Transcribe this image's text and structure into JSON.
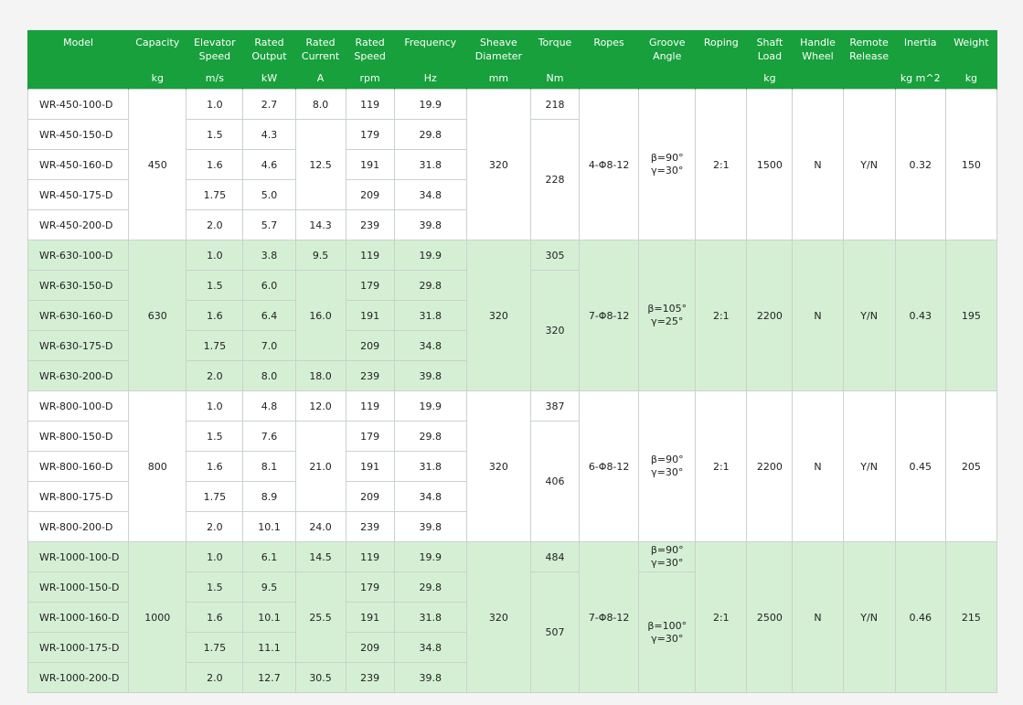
{
  "header": {
    "titles": [
      [
        "Model"
      ],
      [
        "Capacity"
      ],
      [
        "Elevator",
        "Speed"
      ],
      [
        "Rated",
        "Output"
      ],
      [
        "Rated",
        "Current"
      ],
      [
        "Rated",
        "Speed"
      ],
      [
        "Frequency"
      ],
      [
        "Sheave",
        "Diameter"
      ],
      [
        "Torque"
      ],
      [
        "Ropes"
      ],
      [
        "Groove",
        "Angle"
      ],
      [
        "Roping"
      ],
      [
        "Shaft",
        "Load"
      ],
      [
        "Handle",
        "Wheel"
      ],
      [
        "Remote",
        "Release"
      ],
      [
        "Inertia"
      ],
      [
        "Weight"
      ]
    ],
    "units": [
      "",
      "kg",
      "m/s",
      "kW",
      "A",
      "rpm",
      "Hz",
      "mm",
      "Nm",
      "",
      "",
      "",
      "kg",
      "",
      "",
      "kg m^2",
      "kg"
    ]
  },
  "groups": [
    {
      "capacity": "450",
      "sheave": "320",
      "ropes": "4-Φ8-12",
      "roping": "2:1",
      "shaft_load": "1500",
      "handle_wheel": "N",
      "remote_release": "Y/N",
      "inertia": "0.32",
      "weight": "150",
      "groove_angles": [
        [
          "β=90°",
          "γ=30°"
        ]
      ],
      "currents": [
        "8.0",
        "12.5",
        "14.3"
      ],
      "torques": [
        "218",
        "228"
      ],
      "rows": [
        {
          "model": "WR-450-100-D",
          "speed": "1.0",
          "output": "2.7",
          "rpm": "119",
          "hz": "19.9"
        },
        {
          "model": "WR-450-150-D",
          "speed": "1.5",
          "output": "4.3",
          "rpm": "179",
          "hz": "29.8"
        },
        {
          "model": "WR-450-160-D",
          "speed": "1.6",
          "output": "4.6",
          "rpm": "191",
          "hz": "31.8"
        },
        {
          "model": "WR-450-175-D",
          "speed": "1.75",
          "output": "5.0",
          "rpm": "209",
          "hz": "34.8"
        },
        {
          "model": "WR-450-200-D",
          "speed": "2.0",
          "output": "5.7",
          "rpm": "239",
          "hz": "39.8"
        }
      ]
    },
    {
      "capacity": "630",
      "sheave": "320",
      "ropes": "7-Φ8-12",
      "roping": "2:1",
      "shaft_load": "2200",
      "handle_wheel": "N",
      "remote_release": "Y/N",
      "inertia": "0.43",
      "weight": "195",
      "groove_angles": [
        [
          "β=105°",
          "γ=25°"
        ]
      ],
      "currents": [
        "9.5",
        "16.0",
        "18.0"
      ],
      "torques": [
        "305",
        "320"
      ],
      "rows": [
        {
          "model": "WR-630-100-D",
          "speed": "1.0",
          "output": "3.8",
          "rpm": "119",
          "hz": "19.9"
        },
        {
          "model": "WR-630-150-D",
          "speed": "1.5",
          "output": "6.0",
          "rpm": "179",
          "hz": "29.8"
        },
        {
          "model": "WR-630-160-D",
          "speed": "1.6",
          "output": "6.4",
          "rpm": "191",
          "hz": "31.8"
        },
        {
          "model": "WR-630-175-D",
          "speed": "1.75",
          "output": "7.0",
          "rpm": "209",
          "hz": "34.8"
        },
        {
          "model": "WR-630-200-D",
          "speed": "2.0",
          "output": "8.0",
          "rpm": "239",
          "hz": "39.8"
        }
      ]
    },
    {
      "capacity": "800",
      "sheave": "320",
      "ropes": "6-Φ8-12",
      "roping": "2:1",
      "shaft_load": "2200",
      "handle_wheel": "N",
      "remote_release": "Y/N",
      "inertia": "0.45",
      "weight": "205",
      "groove_angles": [
        [
          "β=90°",
          "γ=30°"
        ]
      ],
      "currents": [
        "12.0",
        "21.0",
        "24.0"
      ],
      "torques": [
        "387",
        "406"
      ],
      "rows": [
        {
          "model": "WR-800-100-D",
          "speed": "1.0",
          "output": "4.8",
          "rpm": "119",
          "hz": "19.9"
        },
        {
          "model": "WR-800-150-D",
          "speed": "1.5",
          "output": "7.6",
          "rpm": "179",
          "hz": "29.8"
        },
        {
          "model": "WR-800-160-D",
          "speed": "1.6",
          "output": "8.1",
          "rpm": "191",
          "hz": "31.8"
        },
        {
          "model": "WR-800-175-D",
          "speed": "1.75",
          "output": "8.9",
          "rpm": "209",
          "hz": "34.8"
        },
        {
          "model": "WR-800-200-D",
          "speed": "2.0",
          "output": "10.1",
          "rpm": "239",
          "hz": "39.8"
        }
      ]
    },
    {
      "capacity": "1000",
      "sheave": "320",
      "ropes": "7-Φ8-12",
      "roping": "2:1",
      "shaft_load": "2500",
      "handle_wheel": "N",
      "remote_release": "Y/N",
      "inertia": "0.46",
      "weight": "215",
      "groove_angles": [
        [
          "β=90°",
          "γ=30°"
        ],
        [
          "β=100°",
          "γ=30°"
        ]
      ],
      "currents": [
        "14.5",
        "25.5",
        "30.5"
      ],
      "torques": [
        "484",
        "507"
      ],
      "rows": [
        {
          "model": "WR-1000-100-D",
          "speed": "1.0",
          "output": "6.1",
          "rpm": "119",
          "hz": "19.9"
        },
        {
          "model": "WR-1000-150-D",
          "speed": "1.5",
          "output": "9.5",
          "rpm": "179",
          "hz": "29.8"
        },
        {
          "model": "WR-1000-160-D",
          "speed": "1.6",
          "output": "10.1",
          "rpm": "191",
          "hz": "31.8"
        },
        {
          "model": "WR-1000-175-D",
          "speed": "1.75",
          "output": "11.1",
          "rpm": "209",
          "hz": "34.8"
        },
        {
          "model": "WR-1000-200-D",
          "speed": "2.0",
          "output": "12.7",
          "rpm": "239",
          "hz": "39.8"
        }
      ]
    }
  ],
  "colors": {
    "header_bg": "#17a03c",
    "row_alt_bg": "#d5efd4",
    "row_base_bg": "#ffffff",
    "border": "#c9d3cb",
    "page_bg": "#f4f4f4"
  }
}
